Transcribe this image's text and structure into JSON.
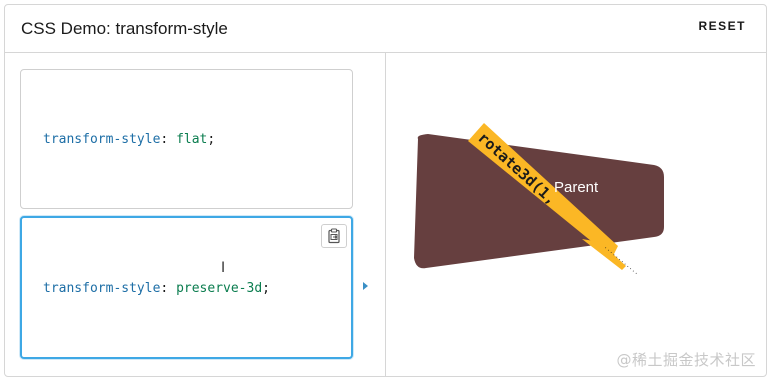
{
  "header": {
    "title": "CSS Demo: transform-style",
    "reset_label": "RESET"
  },
  "choices": [
    {
      "property": "transform-style",
      "colon": ":",
      "value": "flat",
      "semicolon": ";",
      "selected": false
    },
    {
      "property": "transform-style",
      "colon": ":",
      "value": "preserve-3d",
      "semicolon": ";",
      "selected": true
    }
  ],
  "output": {
    "parent_label": "Parent",
    "child_label": "rotate3d(1,",
    "child_sublabel": "............",
    "parent_color": "#663f3f",
    "child_color": "#fbb725"
  },
  "watermark": "@稀土掘金技术社区",
  "icons": {
    "copy": "clipboard-copy-icon",
    "text_cursor": "i-beam-cursor-icon",
    "active_marker": "caret-right-icon"
  }
}
